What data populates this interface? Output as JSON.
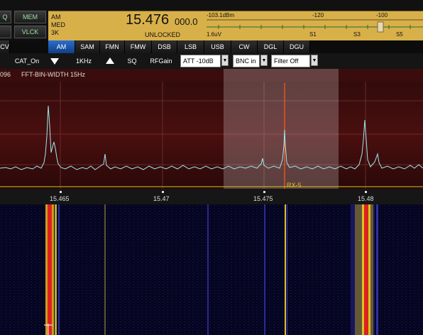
{
  "side_buttons": {
    "mem": "MEM",
    "vlck": "VLCK",
    "left_partial_1": "Q",
    "left_partial_2": "CV"
  },
  "freq_panel": {
    "mode": "AM",
    "bw": "MED",
    "filter": "3K",
    "frequency_main": "15.476",
    "frequency_sub": "000.0",
    "lock_status": "UNLOCKED",
    "dbm_level": "-103.1dBm",
    "uv_level": "1.6uV",
    "meter_scale": [
      "-120",
      "-100"
    ],
    "s_scale": [
      "S1",
      "S3",
      "S5"
    ]
  },
  "modes": {
    "items": [
      "AM",
      "SAM",
      "FMN",
      "FMW",
      "DSB",
      "LSB",
      "USB",
      "CW",
      "DGL",
      "DGU"
    ],
    "active": "AM"
  },
  "controls": {
    "cat": "CAT_On",
    "step": "1KHz",
    "sq": "SQ",
    "rfgain": "RFGain",
    "att": "ATT  -10dB",
    "bnc": "BNC in",
    "filter": "Filter Off"
  },
  "spectrum": {
    "header_left": "096",
    "fft_label": "FFT-BIN-WIDTH 15Hz",
    "rx_marker": "RX-5",
    "freq_labels": [
      "15.465",
      "15.47",
      "15.475",
      "15.48"
    ]
  },
  "colors": {
    "freq_panel": "#d8b04a",
    "mode_active": "#2a6fd0",
    "spectrum_bg": "#4a0f0f",
    "trace": "#9fe8f0",
    "marker": "#ff5a1a",
    "passband": "#ffffff"
  }
}
